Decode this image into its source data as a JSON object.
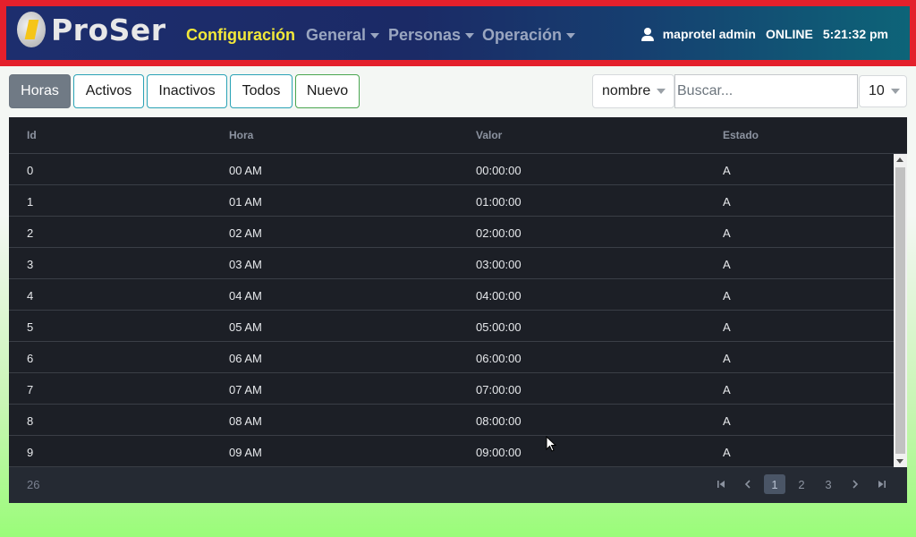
{
  "navbar": {
    "brand": "ProSer",
    "active_item": "Configuración",
    "menus": [
      "General",
      "Personas",
      "Operación"
    ],
    "user": "maprotel admin",
    "status": "ONLINE",
    "time": "5:21:32 pm"
  },
  "toolbar": {
    "buttons": [
      "Horas",
      "Activos",
      "Inactivos",
      "Todos",
      "Nuevo"
    ],
    "search_field": "nombre",
    "search_placeholder": "Buscar...",
    "page_size": "10"
  },
  "table": {
    "columns": [
      "Id",
      "Hora",
      "Valor",
      "Estado"
    ],
    "rows": [
      [
        "0",
        "00 AM",
        "00:00:00",
        "A"
      ],
      [
        "1",
        "01 AM",
        "01:00:00",
        "A"
      ],
      [
        "2",
        "02 AM",
        "02:00:00",
        "A"
      ],
      [
        "3",
        "03 AM",
        "03:00:00",
        "A"
      ],
      [
        "4",
        "04 AM",
        "04:00:00",
        "A"
      ],
      [
        "5",
        "05 AM",
        "05:00:00",
        "A"
      ],
      [
        "6",
        "06 AM",
        "06:00:00",
        "A"
      ],
      [
        "7",
        "07 AM",
        "07:00:00",
        "A"
      ],
      [
        "8",
        "08 AM",
        "08:00:00",
        "A"
      ],
      [
        "9",
        "09 AM",
        "09:00:00",
        "A"
      ]
    ],
    "total": "26",
    "pages": [
      "1",
      "2",
      "3"
    ],
    "current_page": "1"
  },
  "colors": {
    "frame": "#e4202c",
    "active_nav": "#f2e83a",
    "table_bg": "#1c1f26"
  }
}
